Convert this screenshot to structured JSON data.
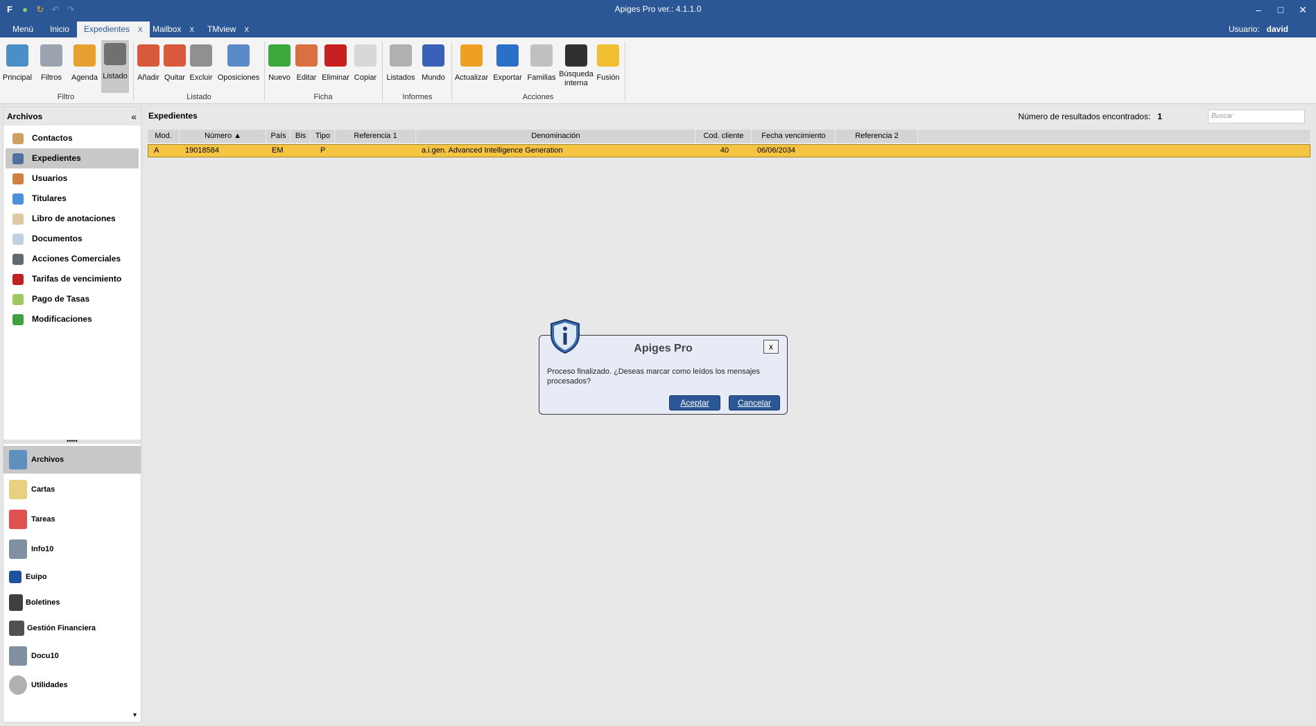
{
  "window": {
    "title": "Apiges Pro ver.: 4.1.1.0"
  },
  "tabs": [
    {
      "label": "Menú"
    },
    {
      "label": "Inicio"
    },
    {
      "label": "Expedientes",
      "close": "X"
    },
    {
      "label": "Mailbox",
      "close": "X"
    },
    {
      "label": "TMview",
      "close": "X"
    }
  ],
  "user": {
    "label": "Usuario:",
    "name": "david"
  },
  "ribbon": {
    "buttons": [
      {
        "label": "Principal",
        "icon": "magnifier-screen-icon",
        "color": "#4a90c8"
      },
      {
        "label": "Filtros",
        "icon": "funnel-icon",
        "color": "#9aa4b0"
      },
      {
        "label": "Agenda",
        "icon": "agenda-icon",
        "color": "#e8a030"
      },
      {
        "label": "Listado",
        "icon": "list-book-icon",
        "color": "#707070"
      },
      {
        "label": "Añadir",
        "icon": "add-list-icon",
        "color": "#d85a3a"
      },
      {
        "label": "Quitar",
        "icon": "remove-list-icon",
        "color": "#d85a3a"
      },
      {
        "label": "Excluir",
        "icon": "exclude-icon",
        "color": "#909090"
      },
      {
        "label": "Oposiciones",
        "icon": "oppositions-icon",
        "color": "#5a8ac8"
      },
      {
        "label": "Nuevo",
        "icon": "plus-icon",
        "color": "#3aa83a"
      },
      {
        "label": "Editar",
        "icon": "edit-icon",
        "color": "#d87040"
      },
      {
        "label": "Eliminar",
        "icon": "delete-icon",
        "color": "#c82020"
      },
      {
        "label": "Copiar",
        "icon": "copy-icon",
        "color": "#d8d8d8"
      },
      {
        "label": "Listados",
        "icon": "clipboard-icon",
        "color": "#b0b0b0"
      },
      {
        "label": "Mundo",
        "icon": "globe-icon",
        "color": "#3a60b8"
      },
      {
        "label": "Actualizar",
        "icon": "refresh-icon",
        "color": "#f0a020"
      },
      {
        "label": "Exportar",
        "icon": "export-arrow-icon",
        "color": "#2a70c8"
      },
      {
        "label": "Familias",
        "icon": "families-icon",
        "color": "#c0c0c0"
      },
      {
        "label": "Búsqueda interna",
        "icon": "binoculars-icon",
        "color": "#303030"
      },
      {
        "label": "Fusión",
        "icon": "merge-icon",
        "color": "#f0c030"
      }
    ],
    "groups": {
      "filtro": "Filtro",
      "listado": "Listado",
      "ficha": "Ficha",
      "informes": "Informes",
      "acciones": "Acciones"
    }
  },
  "sidebar": {
    "title": "Archivos",
    "collapse": "«",
    "items": [
      {
        "label": "Contactos",
        "icon": "contacts-icon",
        "color": "#d0a060"
      },
      {
        "label": "Expedientes",
        "icon": "files-icon",
        "color": "#5070a0"
      },
      {
        "label": "Usuarios",
        "icon": "users-icon",
        "color": "#d08040"
      },
      {
        "label": "Titulares",
        "icon": "holders-icon",
        "color": "#4a90d8"
      },
      {
        "label": "Libro de anotaciones",
        "icon": "notebook-icon",
        "color": "#e0c8a0"
      },
      {
        "label": "Documentos",
        "icon": "documents-icon",
        "color": "#c0d0e0"
      },
      {
        "label": "Acciones Comerciales",
        "icon": "commercial-icon",
        "color": "#606870"
      },
      {
        "label": "Tarifas de vencimiento",
        "icon": "fees-icon",
        "color": "#c02020"
      },
      {
        "label": "Pago de Tasas",
        "icon": "payment-icon",
        "color": "#a0c860"
      },
      {
        "label": "Modificaciones",
        "icon": "modifications-icon",
        "color": "#40a040"
      }
    ],
    "splitter": "•••••",
    "modules": [
      {
        "label": "Archivos",
        "icon": "archive-box-icon",
        "color": "#6090c0"
      },
      {
        "label": "Cartas",
        "icon": "letter-icon",
        "color": "#e8d080"
      },
      {
        "label": "Tareas",
        "icon": "tasks-icon",
        "color": "#e05050"
      },
      {
        "label": "Info10",
        "icon": "info10-icon",
        "color": "#8090a0"
      },
      {
        "label": "Euipo",
        "icon": "euipo-icon",
        "color": "#2050a0"
      },
      {
        "label": "Boletines",
        "icon": "bulletins-icon",
        "color": "#404040"
      },
      {
        "label": "Gestión Financiera",
        "icon": "finance-icon",
        "color": "#505050"
      },
      {
        "label": "Docu10",
        "icon": "docu10-icon",
        "color": "#8090a0"
      },
      {
        "label": "Utilidades",
        "icon": "gear-icon",
        "color": "#b0b0b0"
      }
    ],
    "more": "▾"
  },
  "main": {
    "title": "Expedientes",
    "results_label": "Número de resultados encontrados:",
    "results_count": "1",
    "search_placeholder": "Buscar",
    "columns": [
      "Mod.",
      "Número ▲",
      "País",
      "Bis",
      "Tipo",
      "Referencia 1",
      "Denominación",
      "Cod. cliente",
      "Fecha vencimiento",
      "Referencia 2"
    ],
    "rows": [
      {
        "mod": "A",
        "numero": "19018584",
        "pais": "EM",
        "bis": "",
        "tipo": "P",
        "ref1": "",
        "denominacion": "a.i.gen. Advanced Intelligence Generation",
        "cod": "40",
        "fecha": "06/06/2034",
        "ref2": ""
      }
    ]
  },
  "dialog": {
    "title": "Apiges Pro",
    "close": "x",
    "message": "Proceso finalizado. ¿Deseas marcar como leídos los mensajes procesados?",
    "accept": "Aceptar",
    "cancel": "Cancelar"
  }
}
